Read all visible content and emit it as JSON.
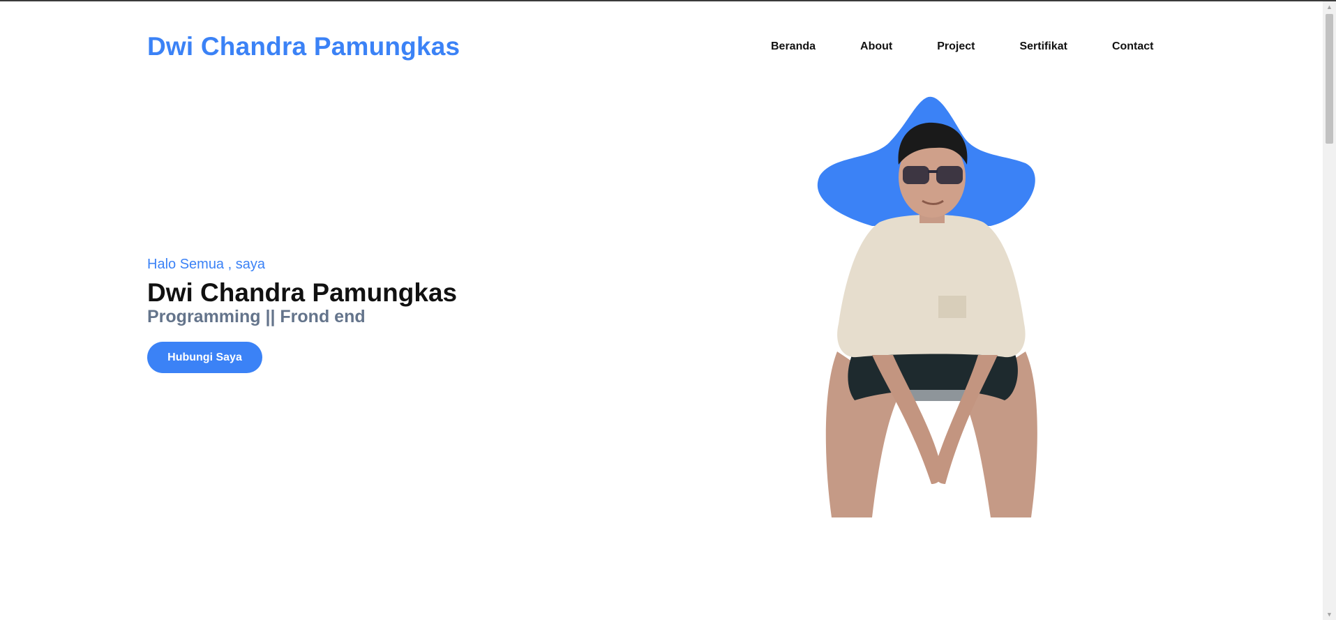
{
  "header": {
    "brand": "Dwi Chandra Pamungkas",
    "nav": [
      "Beranda",
      "About",
      "Project",
      "Sertifikat",
      "Contact"
    ]
  },
  "hero": {
    "greeting": "Halo Semua , saya",
    "name": "Dwi Chandra Pamungkas",
    "role": "Programming || Frond end",
    "cta_label": "Hubungi Saya"
  },
  "colors": {
    "accent": "#3b82f6",
    "text_dark": "#111111",
    "text_muted": "#64748b"
  },
  "icons": {
    "scroll_up": "triangle-up-icon",
    "scroll_down": "triangle-down-icon"
  }
}
